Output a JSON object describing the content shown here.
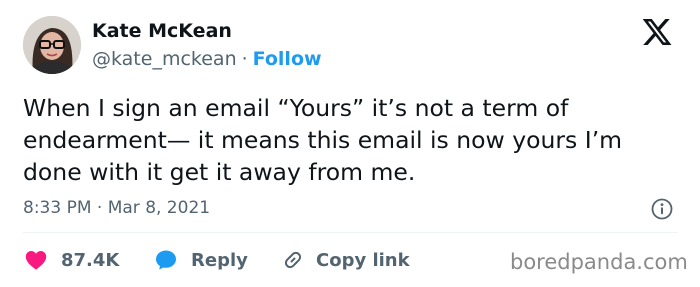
{
  "author": {
    "display_name": "Kate McKean",
    "handle": "@kate_mckean",
    "separator": "·",
    "follow_label": "Follow"
  },
  "tweet": {
    "text_lines": [
      "When I sign an email “Yours” it’s not a term of",
      "endearment— it means this email is now yours I’m",
      "done with it get it away from me."
    ],
    "timestamp": "8:33 PM · Mar 8, 2021"
  },
  "actions": {
    "likes_count": "87.4K",
    "reply_label": "Reply",
    "copy_link_label": "Copy link"
  },
  "icons": {
    "logo": "x-logo-icon",
    "info": "info-icon",
    "like": "heart-icon",
    "reply": "speech-bubble-icon",
    "copy": "link-icon"
  },
  "colors": {
    "text_primary": "#0f1419",
    "text_secondary": "#536471",
    "accent": "#1d9bf0",
    "like": "#f91880",
    "divider": "#eff3f4",
    "watermark": "#8a8a8a"
  },
  "watermark": "boredpanda.com"
}
